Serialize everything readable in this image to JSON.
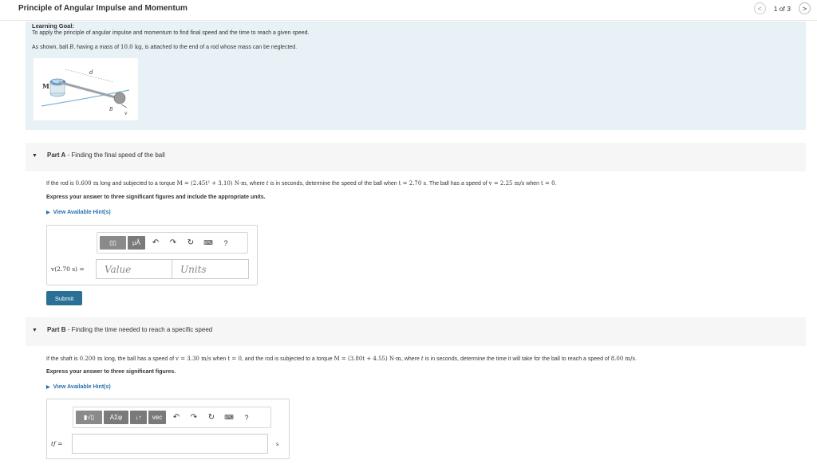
{
  "header": {
    "title": "Principle of Angular Impulse and Momentum",
    "pager": {
      "prev": "<",
      "count": "1 of 3",
      "next": ">"
    }
  },
  "goal": {
    "heading": "Learning Goal:",
    "text1": "To apply the principle of angular impulse and momentum to find final speed and the time to reach a given speed.",
    "text2_pre": "As shown, ball ",
    "text2_b": "B",
    "text2_mid": ", having a mass of ",
    "text2_mass": "10.0 kg",
    "text2_post": ", is attached to the end of a rod whose mass can be neglected.",
    "figure_labels": {
      "m": "M",
      "d": "d",
      "b": "B",
      "v": "v"
    }
  },
  "partA": {
    "label_bold": "Part A",
    "label_rest": " - Finding the final speed of the ball",
    "q1": "If the rod is ",
    "q_len": "0.600 m",
    "q2": " long and subjected to a torque ",
    "q_torque": "M = (2.45t² + 3.10) N·m",
    "q3": ", where ",
    "q_t": "t",
    "q4": " is in seconds, determine the speed of the ball when ",
    "q_tval": "t = 2.70 s",
    "q5": ". The ball has a speed of ",
    "q_v0": "v = 2.25 m/s",
    "q6": " when ",
    "q_t0": "t = 0",
    "q7": ".",
    "instruction": "Express your answer to three significant figures and include the appropriate units.",
    "hint": "View Available Hint(s)",
    "toolbar": {
      "templates": "▯▯",
      "units": "μÅ",
      "help": "?"
    },
    "answer_label": "v(2.70 s) =",
    "value_placeholder": "Value",
    "units_placeholder": "Units",
    "submit": "Submit"
  },
  "partB": {
    "label_bold": "Part B",
    "label_rest": " - Finding the time needed to reach a specific speed",
    "q1": "If the shaft is ",
    "q_len": "0.200 m",
    "q2": " long, the ball has a speed of ",
    "q_v0": "v = 3.30 m/s",
    "q3": " when ",
    "q_t0": "t = 0",
    "q4": ", and the rod is subjected to a torque ",
    "q_torque": "M = (3.80t + 4.55) N·m",
    "q5": ", where ",
    "q_t": "t",
    "q6": " is in seconds, determine the time it will take for the ball to reach a speed of ",
    "q_vf": "8.00 m/s",
    "q7": ".",
    "instruction": "Express your answer to three significant figures.",
    "hint": "View Available Hint(s)",
    "toolbar": {
      "templates": "▮√▯",
      "greek": "ΑΣφ",
      "arrows": "↓↑",
      "vec": "vec",
      "help": "?"
    },
    "answer_label": "tf =",
    "unit": "s"
  }
}
